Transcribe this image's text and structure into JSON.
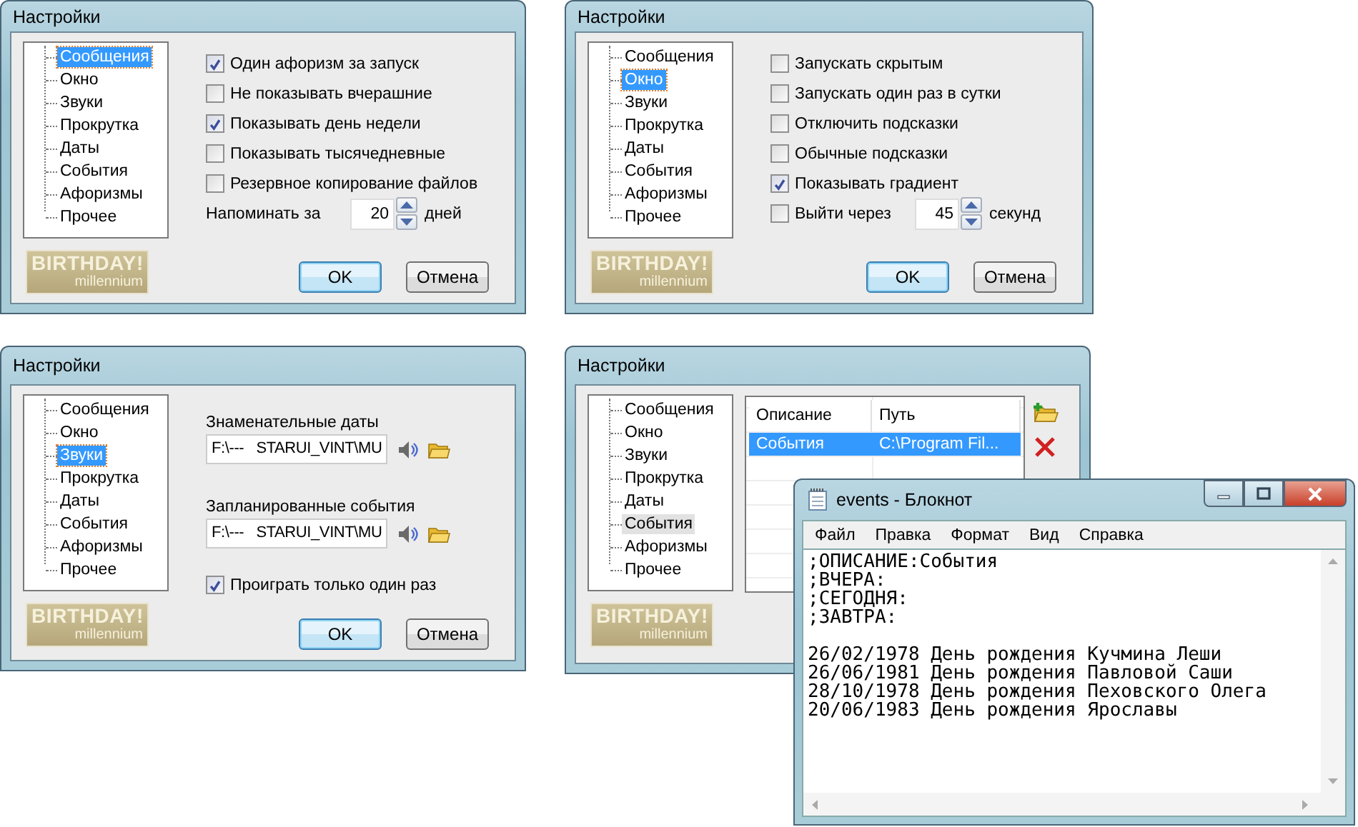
{
  "windows": [
    {
      "kind": "options",
      "title": "Настройки",
      "tree": [
        {
          "label": "Сообщения",
          "selected": true
        },
        {
          "label": "Окно",
          "selected": false
        },
        {
          "label": "Звуки",
          "selected": false
        },
        {
          "label": "Прокрутка",
          "selected": false
        },
        {
          "label": "Даты",
          "selected": false
        },
        {
          "label": "События",
          "selected": false
        },
        {
          "label": "Афоризмы",
          "selected": false
        },
        {
          "label": "Прочее",
          "selected": false
        }
      ],
      "items": [
        {
          "kind": "checkbox",
          "label": "Один афоризм за запуск",
          "checked": true
        },
        {
          "kind": "checkbox",
          "label": "Не показывать вчерашние",
          "checked": false
        },
        {
          "kind": "checkbox",
          "label": "Показывать день недели",
          "checked": true
        },
        {
          "kind": "checkbox",
          "label": "Показывать тысячедневные",
          "checked": false
        },
        {
          "kind": "checkbox",
          "label": "Резервное копирование файлов",
          "checked": false
        },
        {
          "kind": "spinner",
          "label": "Напоминать за",
          "value": "20",
          "unit": "дней"
        }
      ],
      "logo": {
        "title": "BIRTHDAY!",
        "subtitle": "millennium"
      },
      "buttons": [
        {
          "label": "OK",
          "default": true
        },
        {
          "label": "Отмена",
          "default": false
        }
      ]
    },
    {
      "kind": "options",
      "title": "Настройки",
      "tree": [
        {
          "label": "Сообщения",
          "selected": false
        },
        {
          "label": "Окно",
          "selected": true
        },
        {
          "label": "Звуки",
          "selected": false
        },
        {
          "label": "Прокрутка",
          "selected": false
        },
        {
          "label": "Даты",
          "selected": false
        },
        {
          "label": "События",
          "selected": false
        },
        {
          "label": "Афоризмы",
          "selected": false
        },
        {
          "label": "Прочее",
          "selected": false
        }
      ],
      "items": [
        {
          "kind": "checkbox",
          "label": "Запускать скрытым",
          "checked": false
        },
        {
          "kind": "checkbox",
          "label": "Запускать один раз в сутки",
          "checked": false
        },
        {
          "kind": "checkbox",
          "label": "Отключить подсказки",
          "checked": false
        },
        {
          "kind": "checkbox",
          "label": "Обычные подсказки",
          "checked": false
        },
        {
          "kind": "checkbox",
          "label": "Показывать градиент",
          "checked": true
        },
        {
          "kind": "checkbox_spinner",
          "label": "Выйти через",
          "checked": false,
          "value": "45",
          "unit": "секунд"
        }
      ],
      "logo": {
        "title": "BIRTHDAY!",
        "subtitle": "millennium"
      },
      "buttons": [
        {
          "label": "OK",
          "default": true
        },
        {
          "label": "Отмена",
          "default": false
        }
      ]
    },
    {
      "kind": "options",
      "title": "Настройки",
      "tree": [
        {
          "label": "Сообщения",
          "selected": false
        },
        {
          "label": "Окно",
          "selected": false
        },
        {
          "label": "Звуки",
          "selected": true
        },
        {
          "label": "Прокрутка",
          "selected": false
        },
        {
          "label": "Даты",
          "selected": false
        },
        {
          "label": "События",
          "selected": false
        },
        {
          "label": "Афоризмы",
          "selected": false
        },
        {
          "label": "Прочее",
          "selected": false
        }
      ],
      "items": [
        {
          "kind": "file",
          "label": "Знаменательные даты",
          "value": "F:\\---   STARUI_VINT\\MU"
        },
        {
          "kind": "file",
          "label": "Запланированные события",
          "value": "F:\\---   STARUI_VINT\\MU"
        },
        {
          "kind": "checkbox",
          "label": "Проиграть только один раз",
          "checked": true
        }
      ],
      "logo": {
        "title": "BIRTHDAY!",
        "subtitle": "millennium"
      },
      "buttons": [
        {
          "label": "OK",
          "default": true
        },
        {
          "label": "Отмена",
          "default": false
        }
      ]
    },
    {
      "kind": "events",
      "title": "Настройки",
      "tree": [
        {
          "label": "Сообщения",
          "selected": false,
          "hovered": false
        },
        {
          "label": "Окно",
          "selected": false,
          "hovered": false
        },
        {
          "label": "Звуки",
          "selected": false,
          "hovered": false
        },
        {
          "label": "Прокрутка",
          "selected": false,
          "hovered": false
        },
        {
          "label": "Даты",
          "selected": false,
          "hovered": false
        },
        {
          "label": "События",
          "selected": false,
          "hovered": true
        },
        {
          "label": "Афоризмы",
          "selected": false,
          "hovered": false
        },
        {
          "label": "Прочее",
          "selected": false,
          "hovered": false
        }
      ],
      "table": {
        "columns": [
          "Описание",
          "Путь"
        ],
        "rows": [
          {
            "cells": [
              "События",
              "C:\\Program Fil..."
            ],
            "selected": true
          }
        ]
      },
      "logo": {
        "title": "BIRTHDAY!",
        "subtitle": "millennium"
      }
    }
  ],
  "notepad": {
    "title": "events - Блокнот",
    "menu": [
      "Файл",
      "Правка",
      "Формат",
      "Вид",
      "Справка"
    ],
    "content": ";ОПИСАНИЕ:События\n;ВЧЕРА:\n;СЕГОДНЯ:\n;ЗАВТРА:\n\n26/02/1978 День рождения Кучмина Леши\n26/06/1981 День рождения Павловой Саши\n28/10/1978 День рождения Пеховского Олега\n20/06/1983 День рождения Ярославы"
  }
}
